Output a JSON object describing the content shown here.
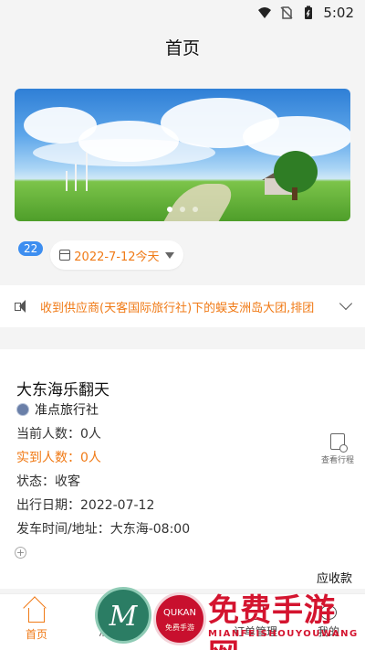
{
  "status_bar": {
    "time": "5:02",
    "icons": [
      "wifi-icon",
      "no-sim-icon",
      "battery-icon"
    ]
  },
  "header": {
    "title": "首页"
  },
  "banner": {
    "slides": 3,
    "active_index": 0
  },
  "date_filter": {
    "badge": "22",
    "date_text": "2022-7-12今天"
  },
  "notice": {
    "text": "收到供应商(天客国际旅行社)下的蜈支洲岛大团,排团"
  },
  "tour_card": {
    "title": "大东海乐翻天",
    "agency": "准点旅行社",
    "current_count": "当前人数：0人",
    "arrived_count": "实到人数：0人",
    "status": "状态：收客",
    "departure_date": "出行日期：2022-07-12",
    "departure_time_place": "发车时间/地址：大东海-08:00",
    "view_itinerary": "查看行程"
  },
  "bottom_nav": {
    "pay_label": "应收款",
    "items": [
      {
        "label": "首页",
        "icon": "home-icon",
        "active": true
      },
      {
        "label": "消息",
        "icon": "message-icon",
        "active": false
      },
      {
        "label": "",
        "icon": "",
        "active": false
      },
      {
        "label": "订单管理",
        "icon": "order-icon",
        "active": false
      },
      {
        "label": "我的",
        "icon": "user-icon",
        "active": false
      }
    ]
  },
  "watermark": {
    "big": "免费手游网",
    "small": "MIANFEISHOUYOUWANG",
    "badge_text": "免费手游",
    "badge_text2": "QUKAN"
  },
  "colors": {
    "accent": "#f07a16",
    "badge": "#3d8ef0"
  }
}
